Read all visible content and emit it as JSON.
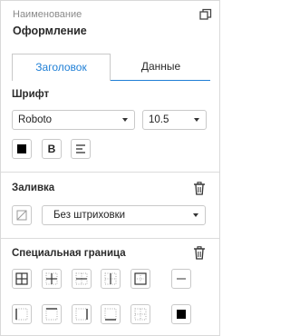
{
  "header": {
    "caption": "Наименование",
    "title": "Оформление"
  },
  "tabs": [
    {
      "label": "Заголовок",
      "active": true
    },
    {
      "label": "Данные",
      "active": false
    }
  ],
  "font_section": {
    "label": "Шрифт",
    "font_family": "Roboto",
    "font_size": "10.5",
    "text_color": "#000000"
  },
  "fill_section": {
    "label": "Заливка",
    "hatch": "Без штриховки"
  },
  "border_section": {
    "label": "Специальная граница",
    "border_color": "#000000"
  },
  "colors": {
    "accent": "#1f7fd6"
  }
}
